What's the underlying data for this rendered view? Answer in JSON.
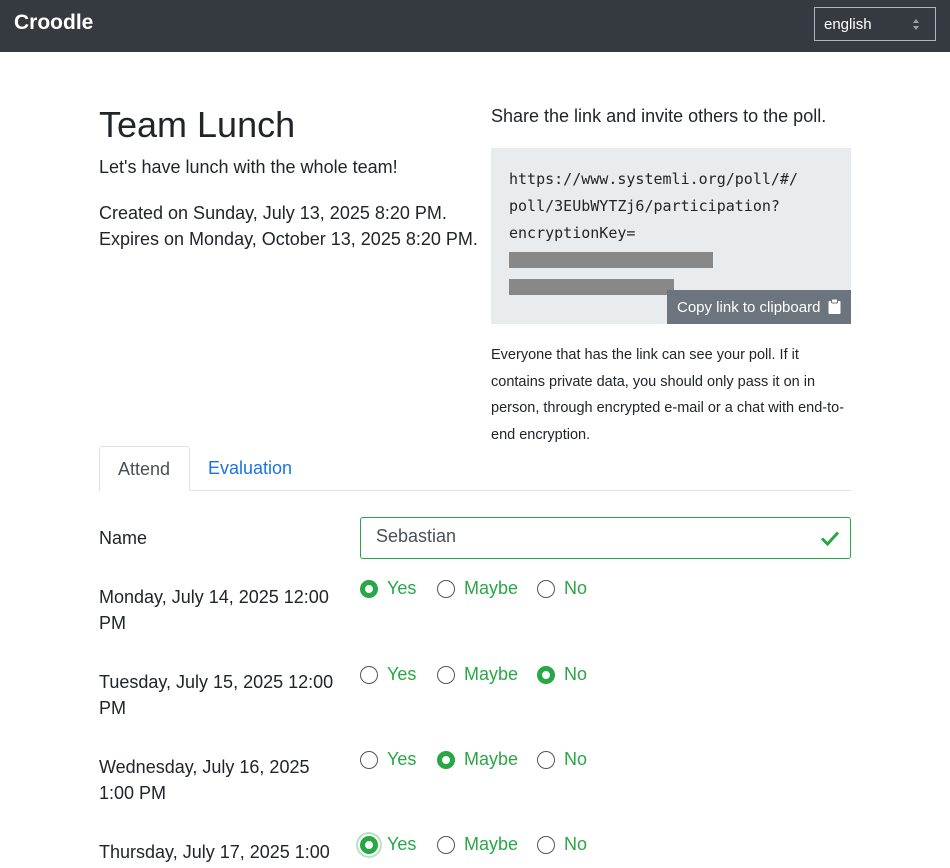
{
  "navbar": {
    "brand": "Croodle",
    "language": "english"
  },
  "poll": {
    "title": "Team Lunch",
    "description": "Let's have lunch with the whole team!",
    "created": "Created on Sunday, July 13, 2025 8:20 PM.",
    "expires": "Expires on Monday, October 13, 2025 8:20 PM."
  },
  "share": {
    "heading": "Share the link and invite others to the poll.",
    "link_line1": "https://www.systemli.org/poll/#/",
    "link_line2": "poll/3EUbWYTZj6/participation?",
    "link_line3": "encryptionKey=",
    "copy_label": "Copy link to clipboard",
    "note": "Everyone that has the link can see your poll. If it contains private data, you should only pass it on in person, through encrypted e-mail or a chat with end-to-end encryption."
  },
  "tabs": [
    "Attend",
    "Evaluation"
  ],
  "form": {
    "name_label": "Name",
    "name_value": "Sebastian",
    "options": [
      "Yes",
      "Maybe",
      "No"
    ],
    "rows": [
      {
        "label": "Monday, July 14, 2025 12:00 PM",
        "selected": "Yes"
      },
      {
        "label": "Tuesday, July 15, 2025 12:00 PM",
        "selected": "No"
      },
      {
        "label": "Wednesday, July 16, 2025 1:00 PM",
        "selected": "Maybe"
      },
      {
        "label": "Thursday, July 17, 2025 1:00",
        "selected": "Yes"
      }
    ]
  },
  "colors": {
    "navbar": "#343a40",
    "success": "#28a745",
    "link": "#1a73e8",
    "secondary_button": "#6c757d"
  },
  "icons": [
    "clipboard-icon",
    "check-icon",
    "select-arrows-icon"
  ]
}
